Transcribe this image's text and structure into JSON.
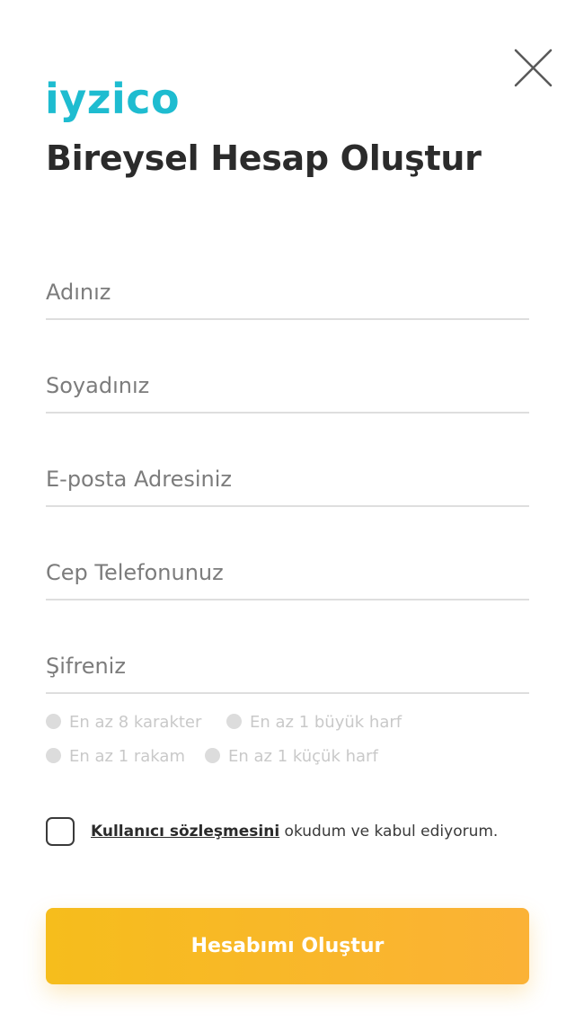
{
  "logo": {
    "text": "iyzico",
    "color": "#1ebcd0"
  },
  "page_title": "Bireysel Hesap Oluştur",
  "close_icon": "close-icon",
  "fields": {
    "first_name": {
      "placeholder": "Adınız",
      "value": ""
    },
    "last_name": {
      "placeholder": "Soyadınız",
      "value": ""
    },
    "email": {
      "placeholder": "E-posta Adresiniz",
      "value": ""
    },
    "phone": {
      "placeholder": "Cep Telefonunuz",
      "value": ""
    },
    "password": {
      "placeholder": "Şifreniz",
      "value": ""
    }
  },
  "password_rules": {
    "min_chars": "En az 8 karakter",
    "uppercase": "En az 1 büyük harf",
    "digit": "En az 1 rakam",
    "lowercase": "En az 1 küçük harf"
  },
  "agreement": {
    "link_text": "Kullanıcı sözleşmesini",
    "rest_text": " okudum ve kabul ediyorum.",
    "checked": false
  },
  "submit_label": "Hesabımı Oluştur",
  "colors": {
    "brand": "#1ebcd0",
    "button_start": "#f6bd1c",
    "button_end": "#fbb236",
    "title": "#2b2b2b",
    "rule_inactive": "#dcdcdc"
  }
}
